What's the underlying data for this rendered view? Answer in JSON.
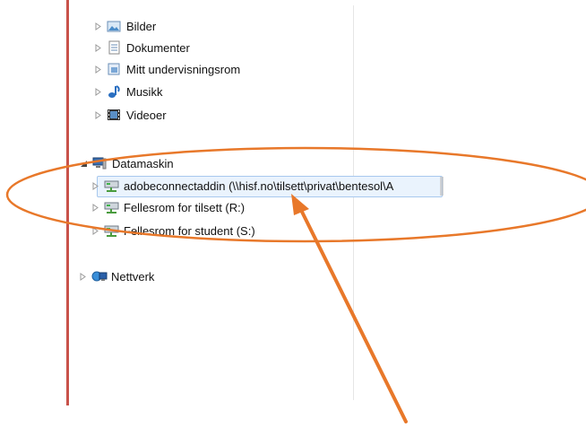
{
  "tree": {
    "libraries": [
      {
        "label": "Bilder",
        "icon": "pictures-folder-icon"
      },
      {
        "label": "Dokumenter",
        "icon": "documents-icon"
      },
      {
        "label": "Mitt undervisningsrom",
        "icon": "library-folder-icon"
      },
      {
        "label": "Musikk",
        "icon": "music-note-icon"
      },
      {
        "label": "Videoer",
        "icon": "film-strip-icon"
      }
    ],
    "computer": {
      "label": "Datamaskin",
      "icon": "computer-icon"
    },
    "drives": [
      {
        "label": "adobeconnectaddin (\\\\hisf.no\\tilsett\\privat\\bentesol\\A",
        "icon": "network-drive-icon"
      },
      {
        "label": "Fellesrom for tilsett (R:)",
        "icon": "network-drive-icon"
      },
      {
        "label": "Fellesrom for student (S:)",
        "icon": "network-drive-icon"
      }
    ],
    "network": {
      "label": "Nettverk",
      "icon": "network-icon"
    }
  },
  "annotation": {
    "ellipse_color": "#e8782a",
    "arrow_color": "#e8782a"
  }
}
